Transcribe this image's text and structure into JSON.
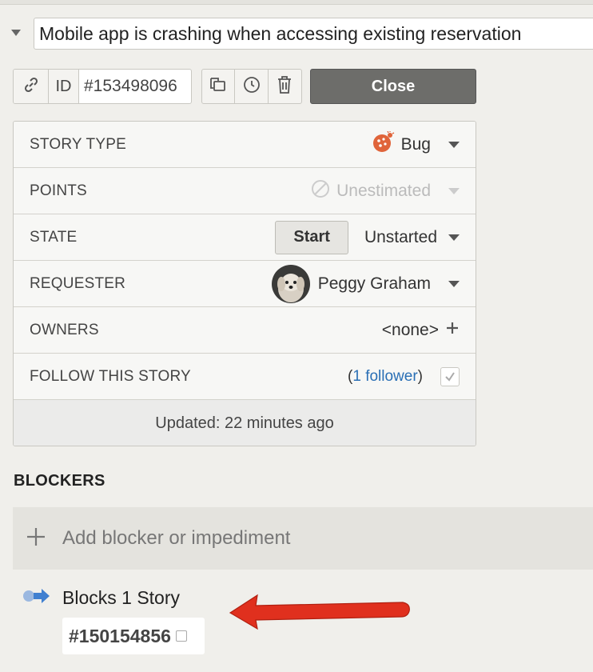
{
  "story": {
    "title": "Mobile app is crashing when accessing existing reservation",
    "id_label": "ID",
    "id_value": "#153498096",
    "close_label": "Close"
  },
  "details": {
    "story_type": {
      "label": "STORY TYPE",
      "value": "Bug",
      "icon": "ladybug-icon"
    },
    "points": {
      "label": "POINTS",
      "value": "Unestimated",
      "icon": "prohibited-icon"
    },
    "state": {
      "label": "STATE",
      "button": "Start",
      "value": "Unstarted"
    },
    "requester": {
      "label": "REQUESTER",
      "value": "Peggy Graham"
    },
    "owners": {
      "label": "OWNERS",
      "value": "<none>"
    },
    "follow": {
      "label": "FOLLOW THIS STORY",
      "open_paren": "(",
      "link": "1 follower",
      "close_paren": ")"
    },
    "updated": "Updated: 22 minutes ago"
  },
  "blockers": {
    "heading": "BLOCKERS",
    "add_placeholder": "Add blocker or impediment",
    "blocks_text": "Blocks 1 Story",
    "blocked_story_id": "#150154856"
  },
  "colors": {
    "background": "#f0efeb",
    "close_button": "#6d6d6a",
    "link": "#2a6fb5",
    "bug_icon": "#e0643a",
    "annotation_arrow": "#e0301e",
    "blocks_icon": "#3f7fd0"
  }
}
